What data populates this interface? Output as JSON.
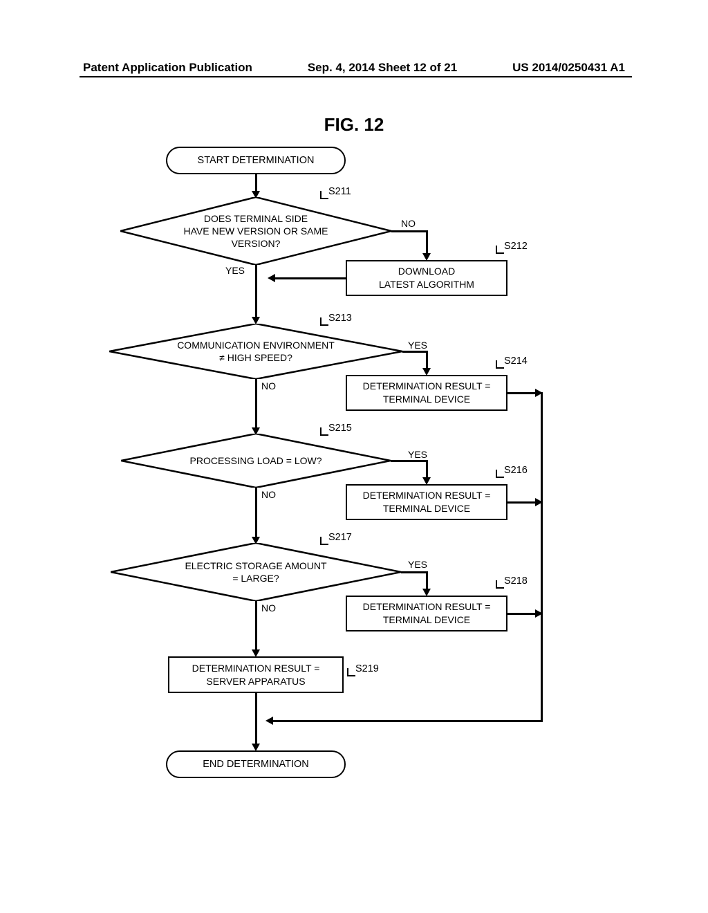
{
  "header": {
    "left": "Patent Application Publication",
    "center": "Sep. 4, 2014  Sheet 12 of 21",
    "right": "US 2014/0250431 A1"
  },
  "figure_title": "FIG. 12",
  "terminator": {
    "start": "START DETERMINATION",
    "end": "END DETERMINATION"
  },
  "diamonds": {
    "s211": {
      "text": "DOES TERMINAL SIDE\nHAVE NEW VERSION OR SAME\nVERSION?",
      "step": "S211"
    },
    "s213": {
      "text": "COMMUNICATION ENVIRONMENT\n≠ HIGH SPEED?",
      "step": "S213"
    },
    "s215": {
      "text": "PROCESSING LOAD = LOW?",
      "step": "S215"
    },
    "s217": {
      "text": "ELECTRIC STORAGE AMOUNT\n= LARGE?",
      "step": "S217"
    }
  },
  "processes": {
    "s212": {
      "text": "DOWNLOAD\nLATEST ALGORITHM",
      "step": "S212"
    },
    "s214": {
      "text": "DETERMINATION RESULT =\nTERMINAL DEVICE",
      "step": "S214"
    },
    "s216": {
      "text": "DETERMINATION RESULT =\nTERMINAL DEVICE",
      "step": "S216"
    },
    "s218": {
      "text": "DETERMINATION RESULT =\nTERMINAL DEVICE",
      "step": "S218"
    },
    "s219": {
      "text": "DETERMINATION RESULT =\nSERVER APPARATUS",
      "step": "S219"
    }
  },
  "labels": {
    "yes": "YES",
    "no": "NO"
  },
  "chart_data": {
    "type": "flowchart",
    "title": "FIG. 12",
    "nodes": [
      {
        "id": "start",
        "type": "terminator",
        "text": "START DETERMINATION"
      },
      {
        "id": "S211",
        "type": "decision",
        "text": "DOES TERMINAL SIDE HAVE NEW VERSION OR SAME VERSION?"
      },
      {
        "id": "S212",
        "type": "process",
        "text": "DOWNLOAD LATEST ALGORITHM"
      },
      {
        "id": "S213",
        "type": "decision",
        "text": "COMMUNICATION ENVIRONMENT ≠ HIGH SPEED?"
      },
      {
        "id": "S214",
        "type": "process",
        "text": "DETERMINATION RESULT = TERMINAL DEVICE"
      },
      {
        "id": "S215",
        "type": "decision",
        "text": "PROCESSING LOAD = LOW?"
      },
      {
        "id": "S216",
        "type": "process",
        "text": "DETERMINATION RESULT = TERMINAL DEVICE"
      },
      {
        "id": "S217",
        "type": "decision",
        "text": "ELECTRIC STORAGE AMOUNT = LARGE?"
      },
      {
        "id": "S218",
        "type": "process",
        "text": "DETERMINATION RESULT = TERMINAL DEVICE"
      },
      {
        "id": "S219",
        "type": "process",
        "text": "DETERMINATION RESULT = SERVER APPARATUS"
      },
      {
        "id": "end",
        "type": "terminator",
        "text": "END DETERMINATION"
      }
    ],
    "edges": [
      {
        "from": "start",
        "to": "S211"
      },
      {
        "from": "S211",
        "to": "S212",
        "label": "NO"
      },
      {
        "from": "S211",
        "to": "S213",
        "label": "YES"
      },
      {
        "from": "S212",
        "to": "S213"
      },
      {
        "from": "S213",
        "to": "S214",
        "label": "YES"
      },
      {
        "from": "S213",
        "to": "S215",
        "label": "NO"
      },
      {
        "from": "S215",
        "to": "S216",
        "label": "YES"
      },
      {
        "from": "S215",
        "to": "S217",
        "label": "NO"
      },
      {
        "from": "S217",
        "to": "S218",
        "label": "YES"
      },
      {
        "from": "S217",
        "to": "S219",
        "label": "NO"
      },
      {
        "from": "S214",
        "to": "end"
      },
      {
        "from": "S216",
        "to": "end"
      },
      {
        "from": "S218",
        "to": "end"
      },
      {
        "from": "S219",
        "to": "end"
      }
    ]
  }
}
